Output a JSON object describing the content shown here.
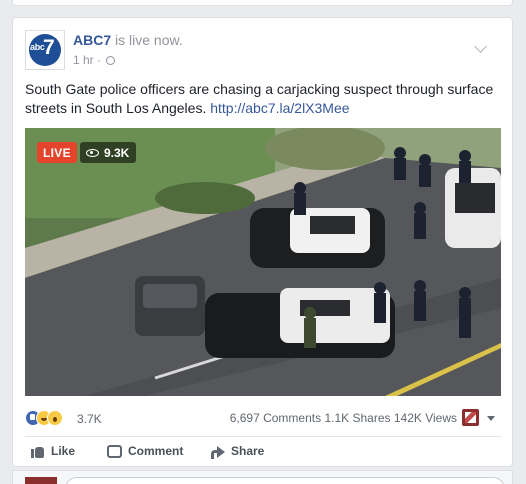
{
  "post": {
    "page_name": "ABC7",
    "status": " is live now.",
    "timestamp": "1 hr",
    "separator": "·",
    "avatar": {
      "label": "abc",
      "number": "7",
      "color": "#1e4e96"
    },
    "text": "South Gate police officers are chasing a carjacking suspect through surface streets in South Los Angeles. ",
    "link": "http://abc7.la/2lX3Mee"
  },
  "video": {
    "live_label": "LIVE",
    "viewer_count": "9.3K",
    "live_color": "#e4442c"
  },
  "stats": {
    "reaction_icons": [
      "like-reaction-icon",
      "haha-reaction-icon",
      "wow-reaction-icon"
    ],
    "reaction_count": "3.7K",
    "comments": "6,697 Comments",
    "shares": "1.1K Shares",
    "views": "142K Views"
  },
  "actions": {
    "like": "Like",
    "comment": "Comment",
    "share": "Share"
  },
  "colors": {
    "link": "#365899",
    "background": "#e9ebee",
    "secondary_text": "#90949c"
  }
}
